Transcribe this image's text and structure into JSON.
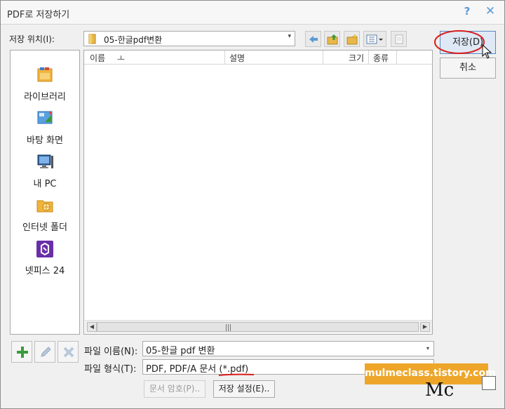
{
  "window": {
    "title": "PDF로 저장하기",
    "help_label": "?",
    "close_label": "✕"
  },
  "location": {
    "label": "저장 위치(I):",
    "value": "05-한글pdf변환",
    "dropdown_arrow": "▾"
  },
  "toolbar": {
    "icons": [
      "back-arrow-icon",
      "up-folder-icon",
      "new-folder-icon",
      "view-menu-icon",
      "properties-icon"
    ],
    "view_menu_arrow": "▾"
  },
  "places": [
    {
      "label": "라이브러리",
      "icon": "library-icon"
    },
    {
      "label": "바탕 화면",
      "icon": "desktop-icon"
    },
    {
      "label": "내 PC",
      "icon": "computer-icon"
    },
    {
      "label": "인터넷 폴더",
      "icon": "internet-folder-icon"
    },
    {
      "label": "넷피스 24",
      "icon": "netffice-icon"
    }
  ],
  "filelist": {
    "columns": [
      {
        "label": "이름",
        "sort_indicator": "ㅗ"
      },
      {
        "label": "설명"
      },
      {
        "label": "크기"
      },
      {
        "label": "종류"
      }
    ],
    "rows": [],
    "scroll_left": "◀",
    "scroll_right": "▶"
  },
  "panel_buttons": [
    "add-icon",
    "edit-icon",
    "delete-icon"
  ],
  "filename": {
    "label": "파일 이름(N):",
    "value": "05-한글 pdf 변환",
    "dropdown_arrow": "▾"
  },
  "filetype": {
    "label": "파일 형식(T):",
    "value": "PDF, PDF/A 문서 (*.pdf)"
  },
  "buttons": {
    "save": "저장(D)",
    "cancel": "취소",
    "doc_password": "문서 암호(P)..",
    "save_settings": "저장 설정(E).."
  },
  "watermark": {
    "text": "mulmeclass.tistory.com",
    "signature": "Mc"
  },
  "colors": {
    "accent": "#5b9bd5",
    "annotation_red": "#d81c1c",
    "watermark_bg": "#eea62a",
    "plus_green": "#3a9a3a"
  }
}
